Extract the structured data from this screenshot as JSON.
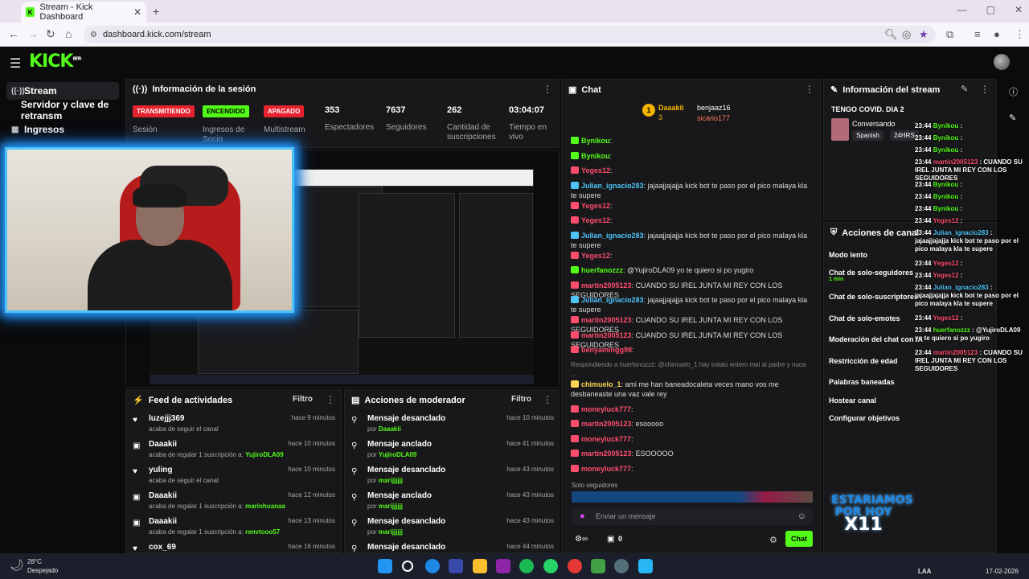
{
  "browser": {
    "tab_title": "Stream - Kick Dashboard",
    "url": "dashboard.kick.com/stream"
  },
  "kick": {
    "logo": "KICK",
    "logo_sup": "BETA"
  },
  "sidebar": {
    "items": [
      {
        "label": "Stream",
        "icon": "stream-icon"
      },
      {
        "label": "Servidor y clave de retransm",
        "icon": "key-icon"
      },
      {
        "label": "Ingresos",
        "icon": "chart-icon"
      }
    ]
  },
  "session": {
    "title": "Información de la sesión",
    "badges": [
      {
        "text": "TRANSMITIENDO",
        "label": "Sesión",
        "color": "#e5232f"
      },
      {
        "text": "ENCENDIDO",
        "label": "Ingresos de Socio",
        "color": "#53fc18"
      },
      {
        "text": "APAGADO",
        "label": "Multistream",
        "color": "#e5232f"
      }
    ],
    "stats": [
      {
        "value": "353",
        "label": "Espectadores"
      },
      {
        "value": "7637",
        "label": "Seguidores"
      },
      {
        "value": "262",
        "label": "Cantidad de suscripciones"
      },
      {
        "value": "03:04:07",
        "label": "Tiempo en vivo"
      }
    ]
  },
  "feed": {
    "title": "Feed de actividades",
    "filter": "Filtro",
    "items": [
      {
        "name": "luzejjj369",
        "desc": "acaba de seguir el canal",
        "time": "hace 9 minutos",
        "icon": "heart-icon"
      },
      {
        "name": "Daaakii",
        "desc": "acaba de regalar 1 suscripción a:",
        "target": "YujiroDLA09",
        "time": "hace 10 minutos",
        "icon": "gift-icon"
      },
      {
        "name": "yuling",
        "desc": "acaba de seguir el canal",
        "time": "hace 10 minutos",
        "icon": "heart-icon"
      },
      {
        "name": "Daaakii",
        "desc": "acaba de regalar 1 suscripción a:",
        "target": "marinhuanaa",
        "time": "hace 12 minutos",
        "icon": "gift-icon"
      },
      {
        "name": "Daaakii",
        "desc": "acaba de regalar 1 suscripción a:",
        "target": "renvtooo57",
        "time": "hace 13 minutos",
        "icon": "gift-icon"
      },
      {
        "name": "cox_69",
        "desc": "",
        "time": "hace 16 minutos",
        "icon": "heart-icon"
      }
    ]
  },
  "mod": {
    "title": "Acciones de moderador",
    "filter": "Filtro",
    "items": [
      {
        "action": "Mensaje desanclado",
        "by": "Daaakii",
        "time": "hace 10 minutos"
      },
      {
        "action": "Mensaje anclado",
        "by": "YujiroDLA09",
        "time": "hace 41 minutos"
      },
      {
        "action": "Mensaje desanclado",
        "by": "marijjjjjj",
        "time": "hace 43 minutos"
      },
      {
        "action": "Mensaje anclado",
        "by": "marijjjjjj",
        "time": "hace 43 minutos"
      },
      {
        "action": "Mensaje desanclado",
        "by": "marijjjjjj",
        "time": "hace 43 minutos"
      },
      {
        "action": "Mensaje desanclado",
        "by": "",
        "time": "hace 44 minutos"
      }
    ]
  },
  "chat": {
    "title": "Chat",
    "top": {
      "user1": "Daaakii",
      "count1": "3",
      "user2": "benjaaz16",
      "user3": "sicario177"
    },
    "messages": [
      {
        "user": "Bynikou",
        "text": "",
        "color": "#53fc18"
      },
      {
        "user": "Bynikou",
        "text": "",
        "color": "#53fc18"
      },
      {
        "user": "Yeges12",
        "text": "",
        "color": "#ff4d6d"
      },
      {
        "user": "Julian_ignacio283",
        "text": "jajaajjajajja kick bot te paso por el pico malaya kla te supere",
        "color": "#4fc3f7"
      },
      {
        "user": "Yeges12",
        "text": "",
        "color": "#ff4d6d"
      },
      {
        "user": "Yeges12",
        "text": "",
        "color": "#ff4d6d"
      },
      {
        "user": "Julian_ignacio283",
        "text": "jajaajjajajja kick bot te paso por el pico malaya kla te supere",
        "color": "#4fc3f7"
      },
      {
        "user": "Yeges12",
        "text": "",
        "color": "#ff4d6d"
      },
      {
        "user": "huerfanozzz",
        "text": "@YujiroDLA09 yo te quiero si po yugiro",
        "color": "#53fc18"
      },
      {
        "user": "martin2005123",
        "text": "CUANDO SU IREL JUNTA MI REY CON LOS SEGUIDORES",
        "color": "#ff4d6d"
      },
      {
        "user": "Julian_ignacio283",
        "text": "jajaajjajajja kick bot te paso por el pico malaya kla te supere",
        "color": "#4fc3f7"
      },
      {
        "user": "martin2005123",
        "text": "CUANDO SU IREL JUNTA MI REY CON LOS SEGUIDORES",
        "color": "#ff4d6d"
      },
      {
        "user": "martin2005123",
        "text": "CUANDO SU IREL JUNTA MI REY CON LOS SEGUIDORES",
        "color": "#ff4d6d"
      },
      {
        "user": "benyamingg98",
        "text": "",
        "color": "#ff4d6d"
      },
      {
        "reply": "Respondiendo a huerfanozzz: @chimuelo_1 hay tratao entero mal al padre y nuca ...",
        "user": "chimuelo_1",
        "text": "ami me han baneadocaleta veces mano vos me desbaneaste una vaz vale rey",
        "color": "#ffd54f"
      },
      {
        "user": "moneyluck777",
        "text": "",
        "color": "#ff4d6d"
      },
      {
        "user": "martin2005123",
        "text": "esooooo",
        "color": "#ff4d6d"
      },
      {
        "user": "moneyluck777",
        "text": "",
        "color": "#ff4d6d"
      },
      {
        "user": "martin2005123",
        "text": "ESOOOOO",
        "color": "#ff4d6d"
      },
      {
        "user": "moneyluck777",
        "text": "",
        "color": "#ff4d6d"
      }
    ],
    "followers_only": "Solo seguidores",
    "input_placeholder": "Enviar un mensaje",
    "send": "Chat",
    "points": "0"
  },
  "info": {
    "title": "Información del stream",
    "stream_title": "TENGO COVID. DIA 2",
    "category": "Conversando",
    "tags": [
      "Spanish",
      "24HRS"
    ],
    "actions_title": "Acciones de canal",
    "actions": [
      {
        "label": "Modo lento",
        "sub": ""
      },
      {
        "label": "Chat de solo-seguidores",
        "sub": "1 min"
      },
      {
        "label": "Chat de solo-suscriptores",
        "sub": ""
      },
      {
        "label": "Chat de solo-emotes",
        "sub": ""
      },
      {
        "label": "Moderación del chat con IA",
        "sub": ""
      },
      {
        "label": "Restricción de edad",
        "sub": ""
      },
      {
        "label": "Palabras baneadas",
        "sub": ""
      },
      {
        "label": "Hostear canal",
        "sub": ""
      },
      {
        "label": "Configurar objetivos",
        "sub": ""
      }
    ]
  },
  "overlay": {
    "logo_line1": "ESTARIAMOS",
    "logo_line2": "POR HOY",
    "logo_line3": "X11",
    "lines": [
      {
        "time": "23:44",
        "user": "Bynikou",
        "text": ""
      },
      {
        "time": "23:44",
        "user": "Bynikou",
        "text": ""
      },
      {
        "time": "23:44",
        "user": "Bynikou",
        "text": ""
      },
      {
        "time": "23:44",
        "user": "martin2005123",
        "text": "CUANDO SU IREL JUNTA MI REY CON LOS SEGUIDORES"
      },
      {
        "time": "23:44",
        "user": "Bynikou",
        "text": ""
      },
      {
        "time": "23:44",
        "user": "Bynikou",
        "text": ""
      },
      {
        "time": "23:44",
        "user": "Bynikou",
        "text": ""
      },
      {
        "time": "23:44",
        "user": "Yeges12",
        "text": ""
      },
      {
        "time": "23:44",
        "user": "Julian_ignacio283",
        "text": "jajaajjajajja kick bot te paso por el pico malaya kla te supere"
      },
      {
        "time": "23:44",
        "user": "Yeges12",
        "text": ""
      },
      {
        "time": "23:44",
        "user": "Yeges12",
        "text": ""
      },
      {
        "time": "23:44",
        "user": "Julian_ignacio283",
        "text": "jajaajjajajja kick bot te paso por el pico malaya kla te supere"
      },
      {
        "time": "23:44",
        "user": "Yeges12",
        "text": ""
      },
      {
        "time": "23:44",
        "user": "huerfanozzz",
        "text": "@YujiroDLA09 yo te quiero si po yugiro"
      },
      {
        "time": "23:44",
        "user": "martin2005123",
        "text": "CUANDO SU IREL JUNTA MI REY CON LOS SEGUIDORES"
      }
    ]
  },
  "taskbar": {
    "temp": "28°C",
    "weather": "Despejado",
    "lang": "LAA",
    "date": "17-02-2026"
  }
}
